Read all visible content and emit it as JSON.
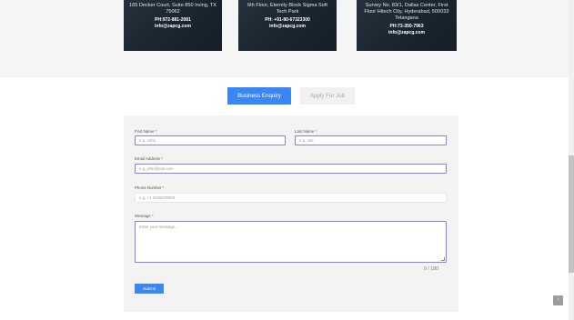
{
  "offices": [
    {
      "address": "165 Decker Court, Suite 850 Irving, TX 75062",
      "phone": "PH:972-881-2081",
      "email": "info@zapcg.com"
    },
    {
      "address": "6th Floor, Eternity Block Sigma Soft Tech Park",
      "phone": "PH: +91-80-67323300",
      "email": "info@zapcg.com"
    },
    {
      "address": "Survey No. 83/1, Dallas Center, First Floor Hitech City, Hyderabad, 500032 Telangana",
      "phone": "PH:73-350-7963",
      "email": "info@zapcg.com"
    }
  ],
  "tabs": {
    "business": "Business Enquiry",
    "job": "Apply For Job"
  },
  "form": {
    "first_name": {
      "label": "First Name",
      "required": "*",
      "placeholder": "e.g. John"
    },
    "last_name": {
      "label": "Last Name",
      "required": "*",
      "placeholder": "e.g. Joe"
    },
    "email": {
      "label": "Email Address",
      "required": "*",
      "placeholder": "e.g. john@site.com"
    },
    "phone": {
      "label": "Phone Number",
      "required": "*",
      "placeholder": "e.g. +1 2345678900"
    },
    "message": {
      "label": "Message",
      "required": "*",
      "placeholder": "Enter your message..."
    },
    "counter": "0 / 180",
    "submit": "Submit"
  },
  "back_to_top_icon": "arrow-up-icon",
  "colors": {
    "primary": "#3a86f5",
    "focus_border": "#8a7fe6",
    "required": "#e03a3a"
  }
}
